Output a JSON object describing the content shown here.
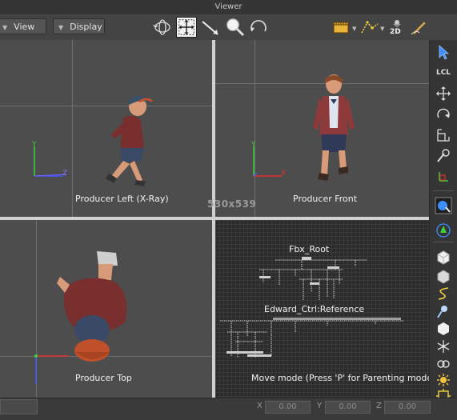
{
  "window": {
    "title": "Viewer"
  },
  "toolbar": {
    "view_label": "View",
    "display_label": "Display",
    "tools": [
      "orbit-tool",
      "translate-view-tool",
      "transform-tool",
      "zoom-tool",
      "undo-view-tool"
    ],
    "right_tools": [
      "frame-display",
      "path-display",
      "2d-view",
      "pen-tool"
    ],
    "badge_2d": "2D"
  },
  "viewports": {
    "top_left": {
      "label": "Producer Left (X-Ray)"
    },
    "top_right": {
      "label": "Producer Front"
    },
    "bottom_left": {
      "label": "Producer Top"
    },
    "bottom_right": {
      "label": "Move mode (Press 'P' for Parenting mode)",
      "schematic_root": "Fbx_Root",
      "schematic_ref": "Edward_Ctrl:Reference"
    }
  },
  "resolution": "530x539",
  "axes": {
    "x": "X",
    "y": "Y",
    "z": "Z"
  },
  "right_bar": {
    "lcl_label": "LCL"
  },
  "status": {
    "x_label": "X",
    "x_value": "0.00",
    "y_label": "Y",
    "y_value": "0.00",
    "z_label": "Z",
    "z_value": "0.00"
  },
  "colors": {
    "accent_blue": "#3d8fff",
    "axis_green": "#3cd23c",
    "axis_red": "#e03232"
  }
}
